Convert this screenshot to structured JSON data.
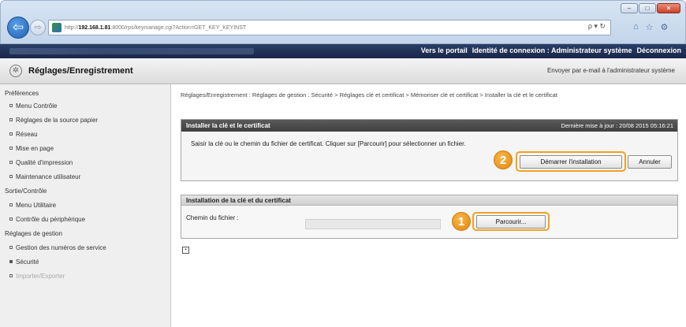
{
  "browser": {
    "window_buttons": [
      "–",
      "□",
      "✕"
    ],
    "back_glyph": "⇦",
    "forward_glyph": "⇨",
    "url_prefix": "http://",
    "url_host": "192.168.1.81",
    "url_rest": ":8000/rps/keymanage.cgi?Action=GET_KEY_KEYINST",
    "addr_tools": "ρ ▾ ↻",
    "toolbar_icons": [
      "⌂",
      "☆",
      "⚙"
    ]
  },
  "topbar": {
    "links": [
      "Vers le portail",
      "Identité de connexion : Administrateur système",
      "Déconnexion"
    ]
  },
  "header": {
    "title": "Réglages/Enregistrement",
    "email_link": "Envoyer par e-mail à l'administrateur système"
  },
  "sidebar": {
    "sections": [
      {
        "heading": "Préférences",
        "items": [
          "Menu Contrôle",
          "Réglages de la source papier",
          "Réseau",
          "Mise en page",
          "Qualité d'impression",
          "Maintenance utilisateur"
        ]
      },
      {
        "heading": "Sortie/Contrôle",
        "items": [
          "Menu Utilitaire",
          "Contrôle du périphérique"
        ]
      },
      {
        "heading": "Réglages de gestion",
        "items": [
          "Gestion des numéros de service",
          "Sécurité",
          "Importer/Exporter"
        ]
      }
    ]
  },
  "main": {
    "breadcrumb": "Réglages/Enregistrement : Réglages de gestion : Sécurité > Réglages clé et certificat > Mémoriser clé et certificat > Installer la clé et le certificat",
    "install": {
      "title": "Installer la clé et le certificat",
      "updated": "Dernière mise à jour : 20/08 2015 05:16:21",
      "instruction": "Saisir la clé ou le chemin du fichier de certificat. Cliquer sur [Parcourir] pour sélectionner un fichier.",
      "start_button": "Démarrer l'installation",
      "cancel_button": "Annuler"
    },
    "cert": {
      "title": "Installation de la clé et du certificat",
      "file_label": "Chemin du fichier :",
      "browse_button": "Parcourir...",
      "file_value": ""
    },
    "badges": [
      "1",
      "2"
    ]
  }
}
